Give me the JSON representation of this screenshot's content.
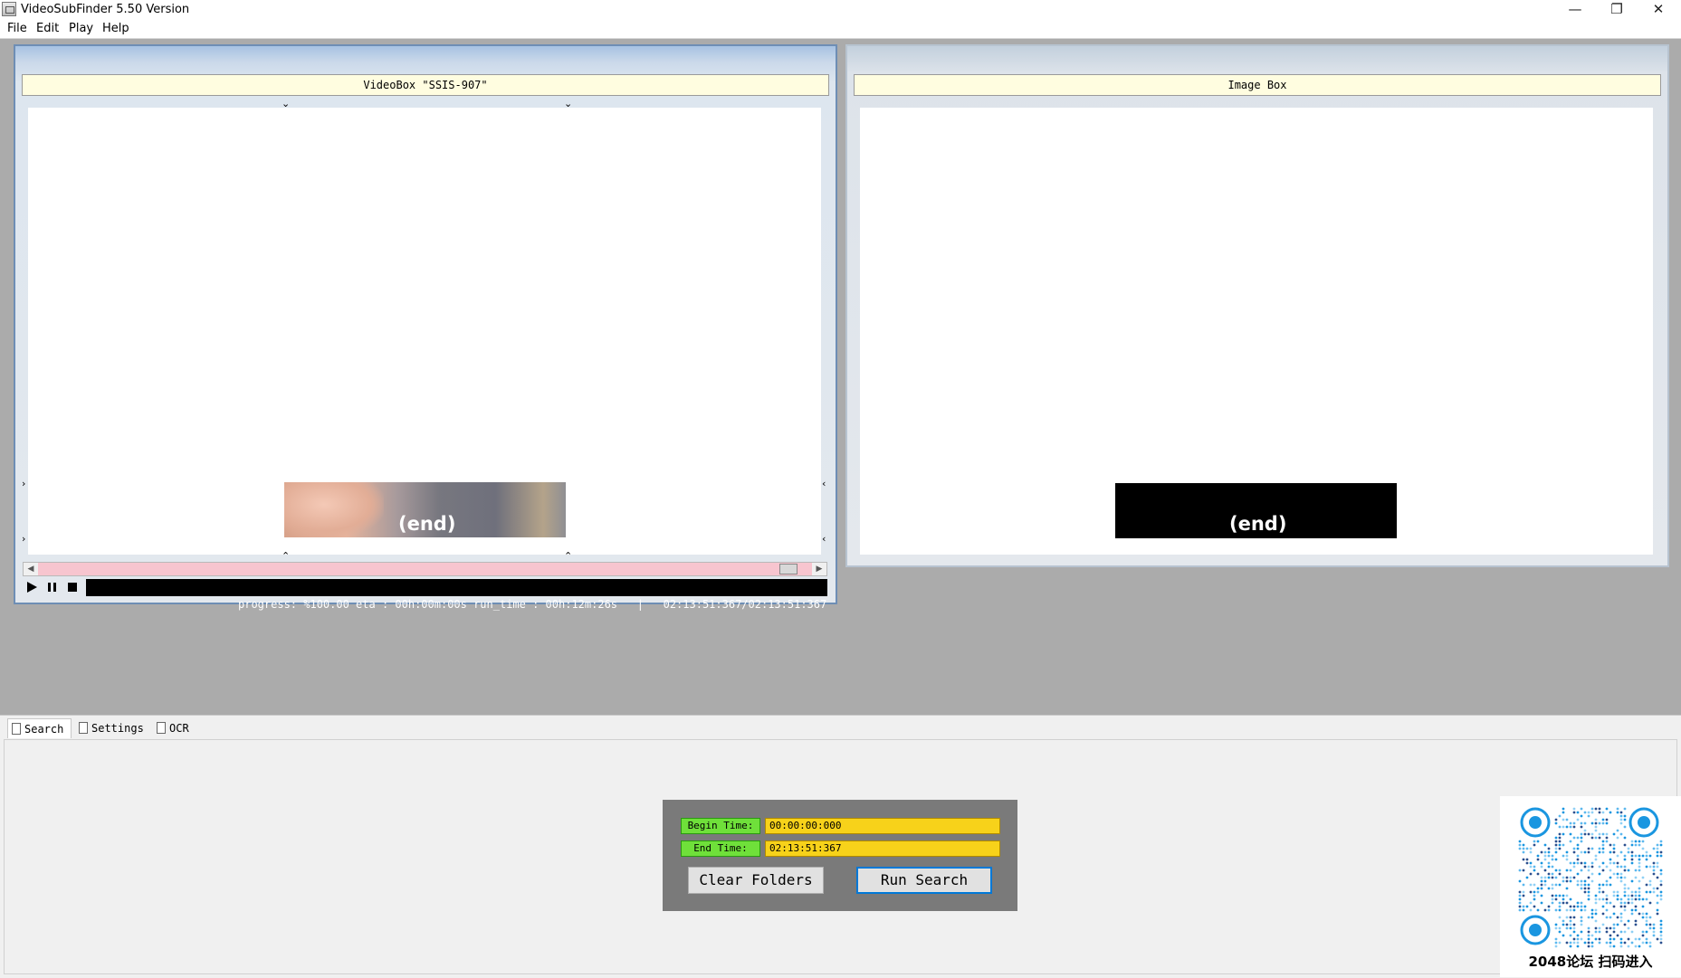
{
  "window": {
    "title": "VideoSubFinder 5.50 Version",
    "controls": {
      "minimize": "—",
      "restore": "❐",
      "close": "✕"
    }
  },
  "menu": [
    "File",
    "Edit",
    "Play",
    "Help"
  ],
  "video_box": {
    "title": "VideoBox \"SSIS-907\"",
    "subtitle_text": "(end)",
    "playback": {
      "play": "▶",
      "pause": "❚❚",
      "stop": "■"
    },
    "status": "progress: %100.00 eta : 00h:00m:00s run_time : 00h:12m:26s   |   02:13:51:367/02:13:51:367",
    "scroll_position": 1.0
  },
  "image_box": {
    "title": "Image Box",
    "subtitle_text": "(end)"
  },
  "tabs": [
    {
      "label": "Search",
      "active": true
    },
    {
      "label": "Settings",
      "active": false
    },
    {
      "label": "OCR",
      "active": false
    }
  ],
  "search": {
    "begin_label": "Begin Time:",
    "begin_value": "00:00:00:000",
    "end_label": "End Time:",
    "end_value": "02:13:51:367",
    "clear_button": "Clear Folders",
    "run_button": "Run Search"
  },
  "qr": {
    "caption": "2048论坛 扫码进入"
  },
  "colors": {
    "label_green": "#6fe03a",
    "input_yellow": "#f7d21a",
    "header_bg": "#fffde0",
    "scroll_pink": "#f7c5cf"
  }
}
